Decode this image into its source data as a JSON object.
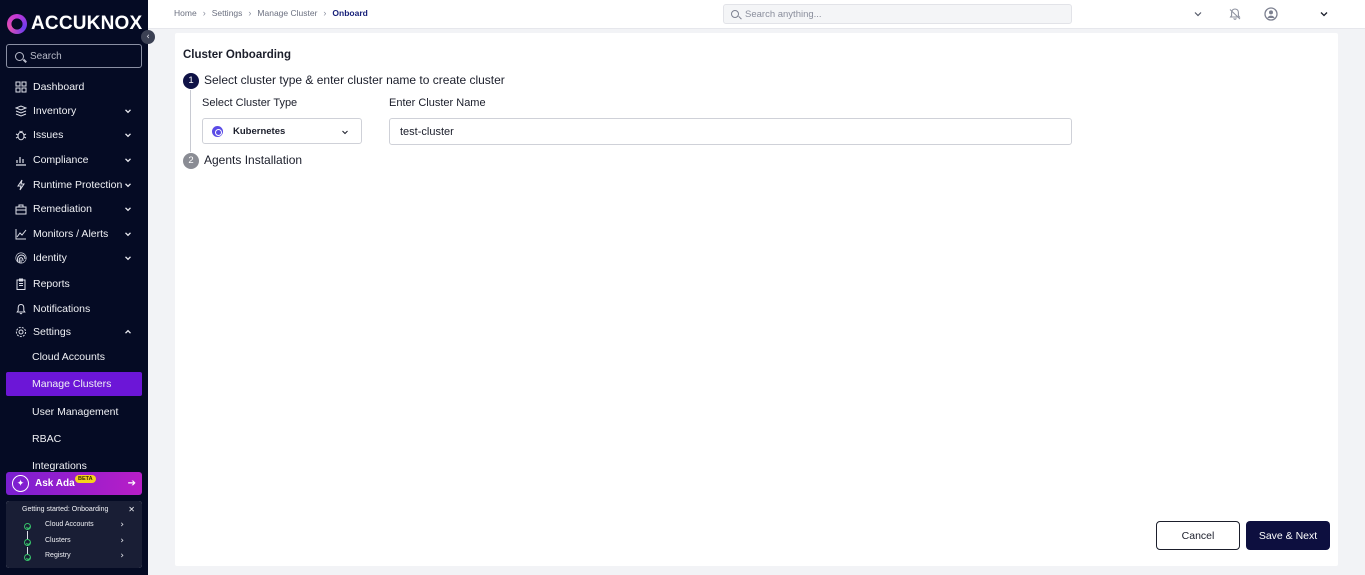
{
  "brand": {
    "name": "ACCUKNOX"
  },
  "sidebar": {
    "search_placeholder": "Search",
    "items": [
      {
        "label": "Dashboard",
        "icon": "dashboard-icon",
        "has_chevron": false
      },
      {
        "label": "Inventory",
        "icon": "inventory-icon",
        "has_chevron": true
      },
      {
        "label": "Issues",
        "icon": "bug-icon",
        "has_chevron": true
      },
      {
        "label": "Compliance",
        "icon": "chart-icon",
        "has_chevron": true
      },
      {
        "label": "Runtime Protection",
        "icon": "bolt-icon",
        "has_chevron": true
      },
      {
        "label": "Remediation",
        "icon": "toolbox-icon",
        "has_chevron": true
      },
      {
        "label": "Monitors / Alerts",
        "icon": "line-chart-icon",
        "has_chevron": true
      },
      {
        "label": "Identity",
        "icon": "fingerprint-icon",
        "has_chevron": true
      },
      {
        "label": "Reports",
        "icon": "clipboard-icon",
        "has_chevron": false
      },
      {
        "label": "Notifications",
        "icon": "bell-icon",
        "has_chevron": false
      },
      {
        "label": "Settings",
        "icon": "gear-icon",
        "has_chevron": true,
        "expanded": true
      }
    ],
    "sub_items": [
      {
        "label": "Cloud Accounts",
        "active": false
      },
      {
        "label": "Manage Clusters",
        "active": true
      },
      {
        "label": "User Management",
        "active": false
      },
      {
        "label": "RBAC",
        "active": false
      },
      {
        "label": "Integrations",
        "active": false
      }
    ],
    "ask_ada": {
      "label": "Ask Ada",
      "badge": "BETA"
    },
    "onboarding": {
      "title": "Getting started: Onboarding",
      "steps": [
        "Cloud Accounts",
        "Clusters",
        "Registry"
      ]
    }
  },
  "topbar": {
    "breadcrumb": [
      "Home",
      "Settings",
      "Manage Cluster",
      "Onboard"
    ],
    "search_placeholder": "Search anything..."
  },
  "main": {
    "title": "Cluster Onboarding",
    "step1": {
      "number": "1",
      "title": "Select cluster type & enter cluster name to create cluster",
      "type_label": "Select Cluster Type",
      "type_value": "Kubernetes",
      "name_label": "Enter Cluster Name",
      "name_value": "test-cluster"
    },
    "step2": {
      "number": "2",
      "title": "Agents Installation"
    },
    "buttons": {
      "cancel": "Cancel",
      "save_next": "Save & Next"
    }
  },
  "colors": {
    "sidebar_bg": "#050b24",
    "active_item": "#6c16d7",
    "primary_button": "#0d0f3f",
    "step_active": "#0f1246",
    "step_inactive": "#8a8c94"
  }
}
